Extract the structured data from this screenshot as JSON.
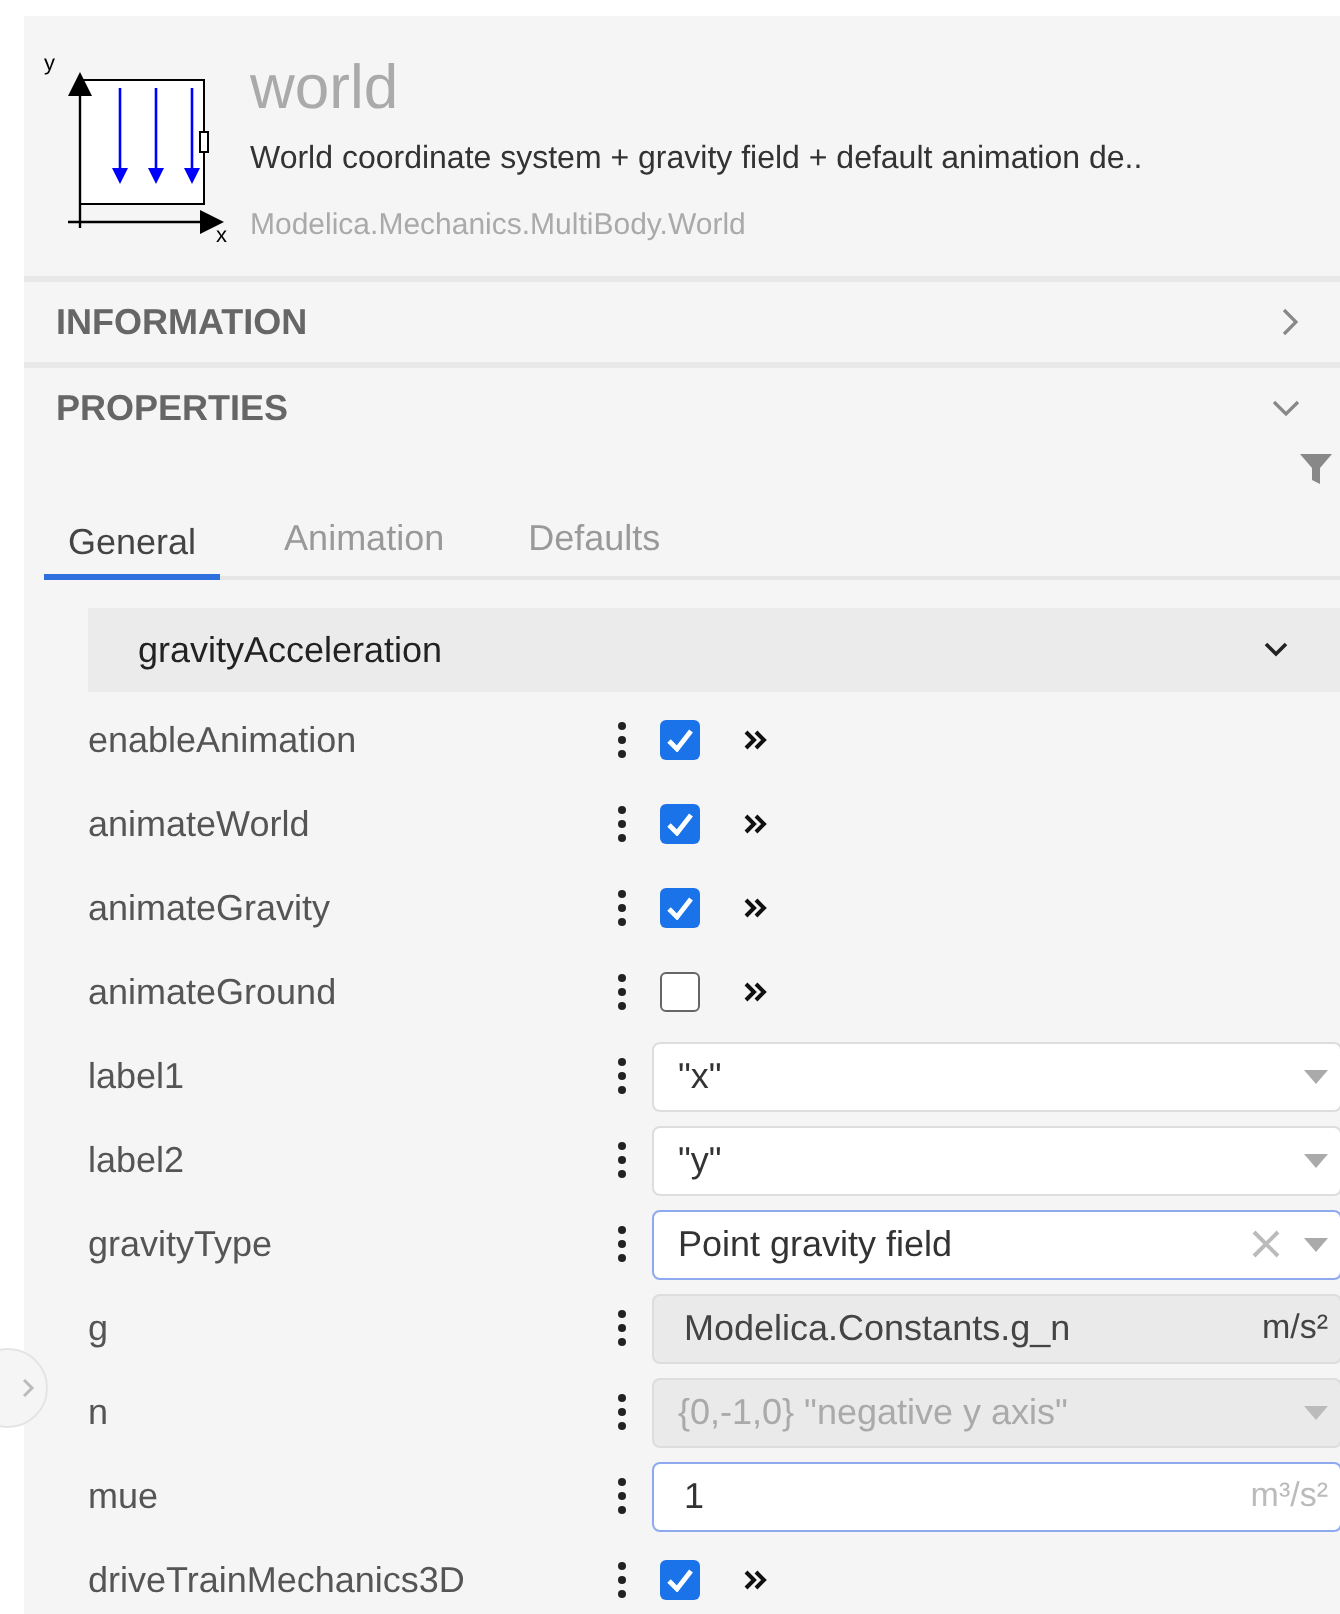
{
  "header": {
    "axis_labels": [
      "y",
      "x"
    ],
    "title": "world",
    "description": "World coordinate system + gravity field + default animation de..",
    "path": "Modelica.Mechanics.MultiBody.World"
  },
  "sections": [
    {
      "title": "INFORMATION",
      "expanded": false
    },
    {
      "title": "PROPERTIES",
      "expanded": true
    }
  ],
  "tabs": [
    {
      "label": "General",
      "selected": true
    },
    {
      "label": "Animation",
      "selected": false
    },
    {
      "label": "Defaults",
      "selected": false
    }
  ],
  "group": {
    "title": "gravityAcceleration",
    "expanded": true
  },
  "parameters": [
    {
      "name": "enableAnimation",
      "kind": "checkbox",
      "checked": true
    },
    {
      "name": "animateWorld",
      "kind": "checkbox",
      "checked": true
    },
    {
      "name": "animateGravity",
      "kind": "checkbox",
      "checked": true
    },
    {
      "name": "animateGround",
      "kind": "checkbox",
      "checked": false
    },
    {
      "name": "label1",
      "kind": "dropdown",
      "value": "\"x\"",
      "focused": false,
      "disabled": false,
      "clearable": false
    },
    {
      "name": "label2",
      "kind": "dropdown",
      "value": "\"y\"",
      "focused": false,
      "disabled": false,
      "clearable": false
    },
    {
      "name": "gravityType",
      "kind": "dropdown",
      "value": "Point gravity field",
      "focused": true,
      "disabled": false,
      "clearable": true
    },
    {
      "name": "g",
      "kind": "input",
      "value": "Modelica.Constants.g_n",
      "unit": "m/s²",
      "focused": false,
      "disabled": true
    },
    {
      "name": "n",
      "kind": "dropdown",
      "value": "{0,-1,0} \"negative y axis\"",
      "focused": false,
      "disabled": true,
      "clearable": false
    },
    {
      "name": "mue",
      "kind": "input",
      "value": "1",
      "unit": "m³/s²",
      "focused": true,
      "disabled": false
    },
    {
      "name": "driveTrainMechanics3D",
      "kind": "checkbox",
      "checked": true
    }
  ]
}
